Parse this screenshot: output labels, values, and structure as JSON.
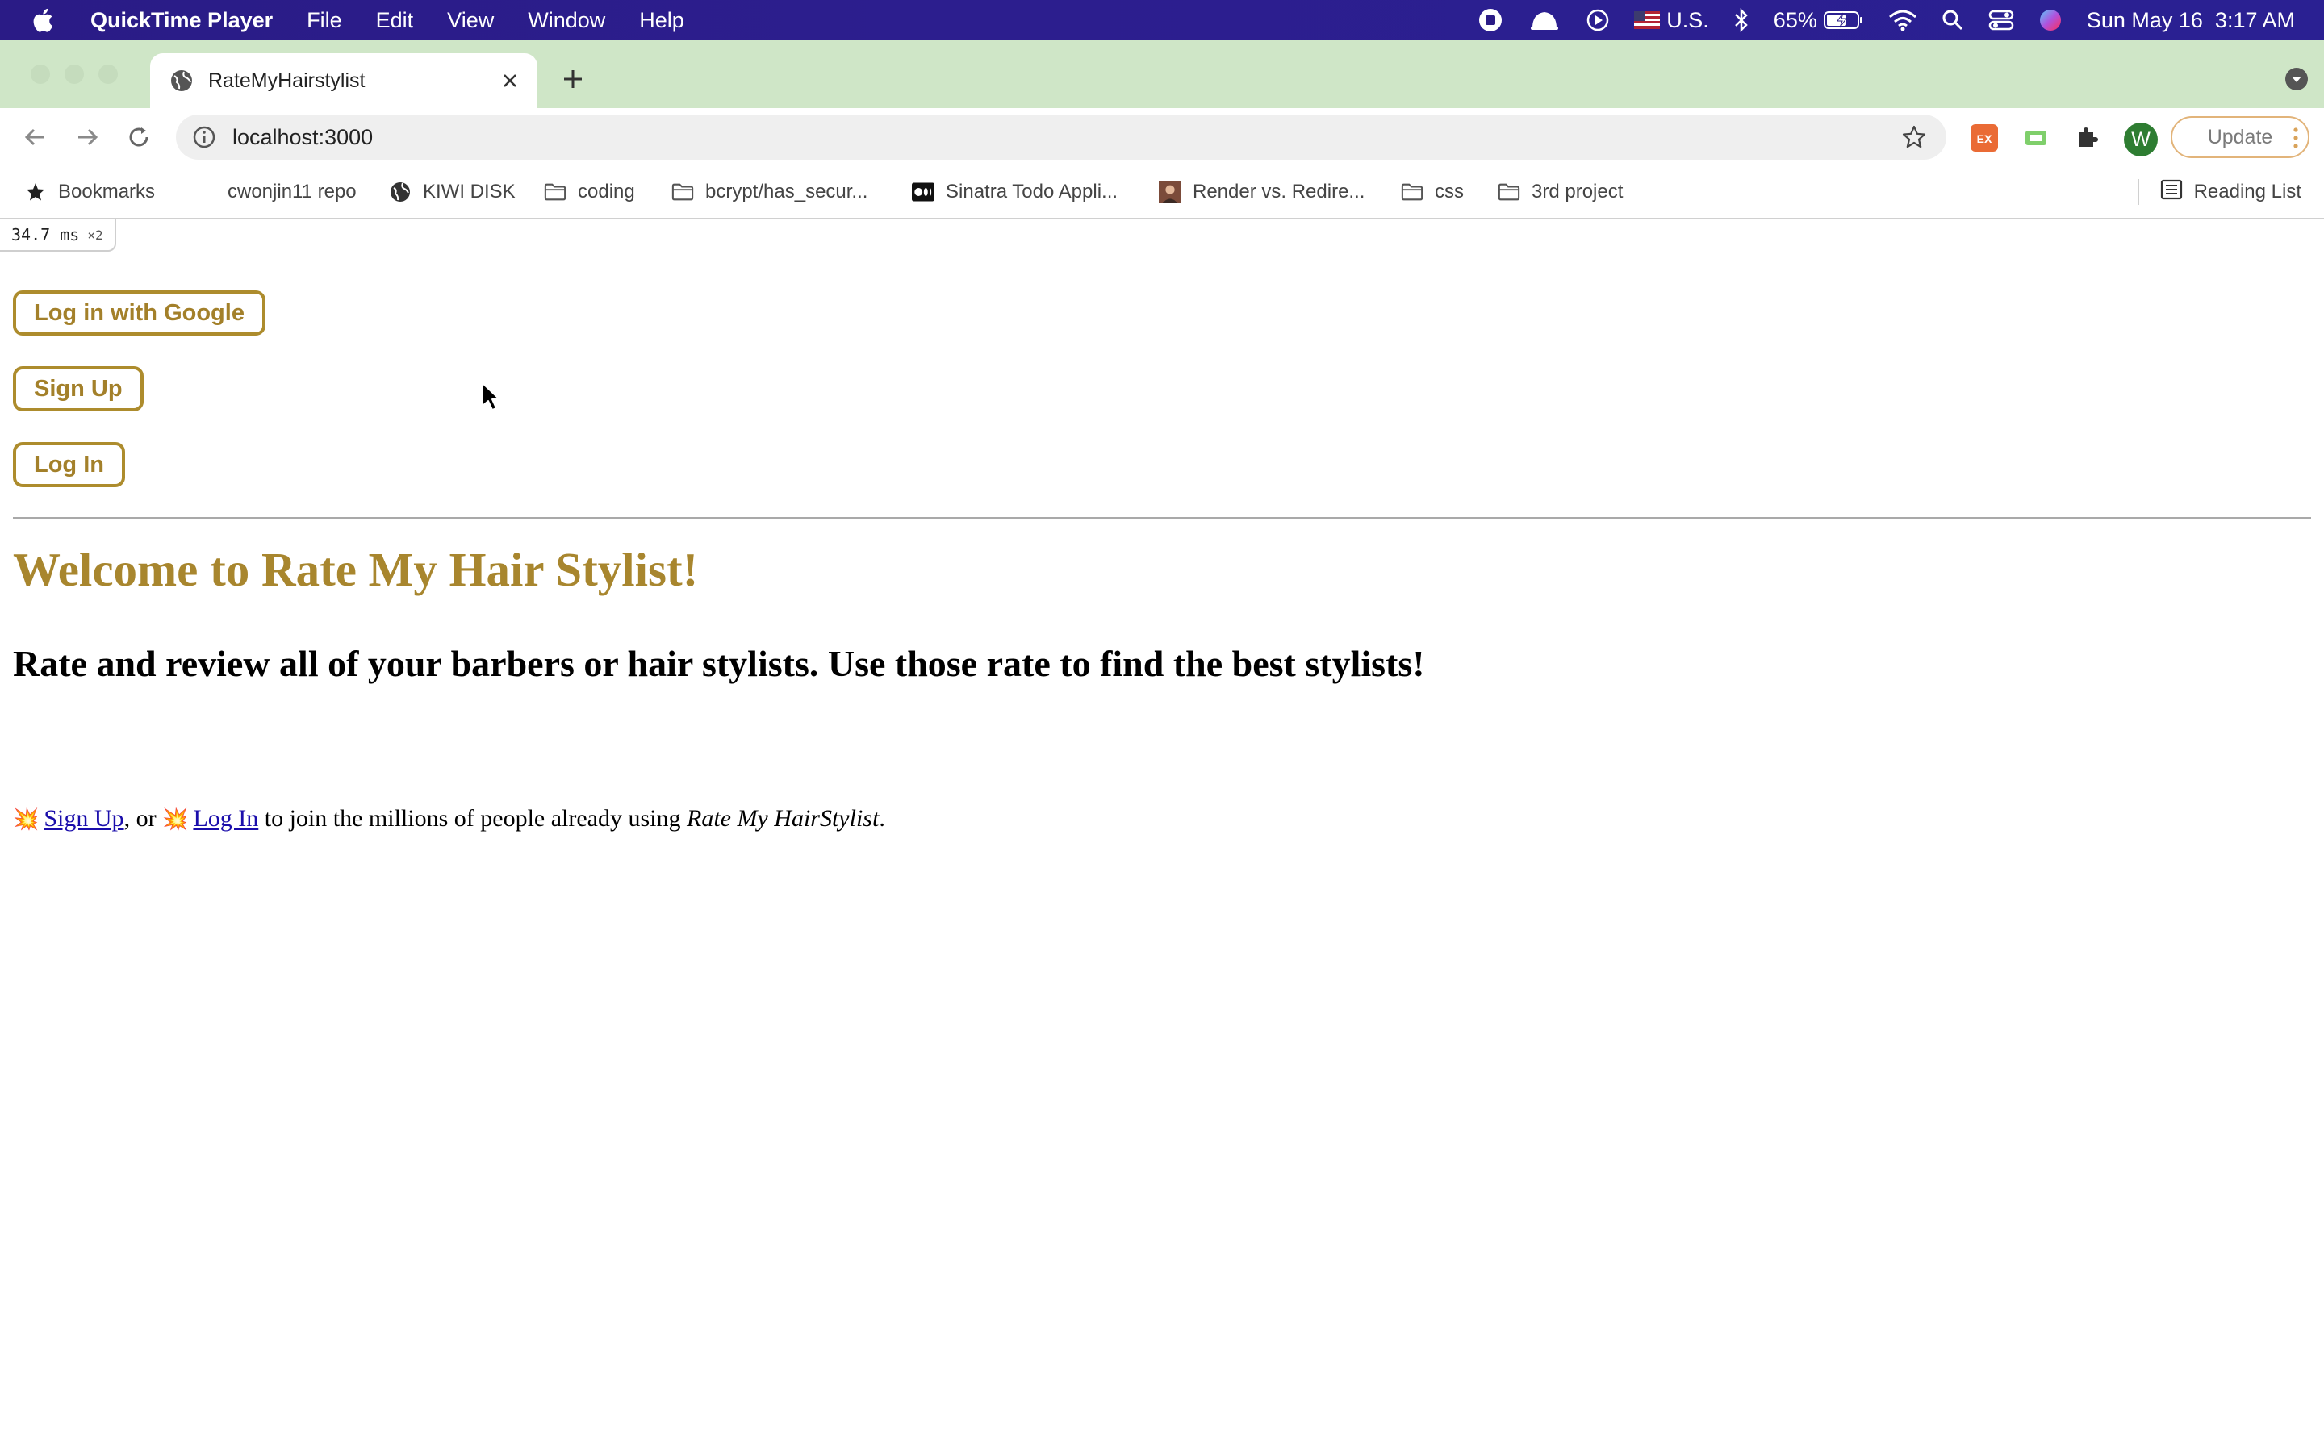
{
  "menubar": {
    "app_name": "QuickTime Player",
    "items": [
      "File",
      "Edit",
      "View",
      "Window",
      "Help"
    ],
    "input_source": "U.S.",
    "battery": "65%",
    "datetime": "Sun May 16  3:17 AM"
  },
  "browser": {
    "tab": {
      "title": "RateMyHairstylist"
    },
    "address": {
      "url": "localhost:3000"
    },
    "profile_initial": "W",
    "update_label": "Update",
    "bookmarks": [
      {
        "label": "Bookmarks",
        "icon": "star-icon"
      },
      {
        "label": "cwonjin11 repo",
        "icon": "github-icon"
      },
      {
        "label": "KIWI DISK",
        "icon": "globe-icon"
      },
      {
        "label": "coding",
        "icon": "folder-icon"
      },
      {
        "label": "bcrypt/has_secur...",
        "icon": "folder-icon"
      },
      {
        "label": "Sinatra Todo Appli...",
        "icon": "medium-icon"
      },
      {
        "label": "Render vs. Redire...",
        "icon": "photo-icon"
      },
      {
        "label": "css",
        "icon": "folder-icon"
      },
      {
        "label": "3rd project",
        "icon": "folder-icon"
      }
    ],
    "reading_list": "Reading List"
  },
  "page": {
    "perf": {
      "value": "34.7",
      "unit": "ms",
      "multiplier": "×2"
    },
    "buttons": {
      "google": "Log in with Google",
      "signup": "Sign Up",
      "login": "Log In"
    },
    "heading": "Welcome to Rate My Hair Stylist!",
    "subheading": "Rate and review all of your barbers or hair stylists. Use those rate to find the best stylists!",
    "cta": {
      "burst": "💥",
      "signup_link": "Sign Up",
      "sep": ", or ",
      "login_link": "Log In",
      "text": " to join the millions of people already using ",
      "brand": "Rate My HairStylist",
      "end": "."
    }
  },
  "colors": {
    "menubar": "#2a1b86",
    "tabstrip": "#cfe6c7",
    "accent_gold": "#a8862e",
    "link": "#1a0dab"
  }
}
